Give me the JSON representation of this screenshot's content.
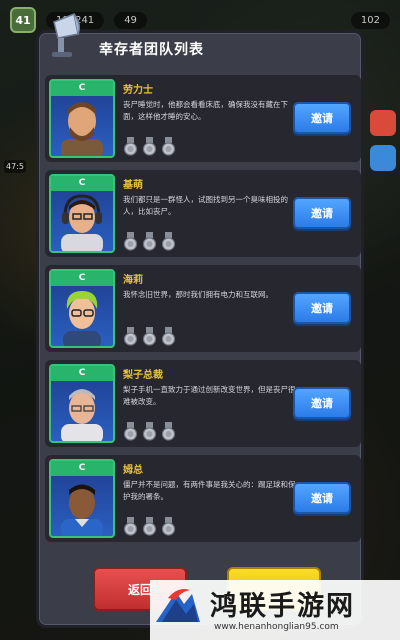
{
  "topbar": {
    "level": "41",
    "resource_left": "193241",
    "resource_mid": "49",
    "resource_right": "102"
  },
  "side": {
    "timer": "47:5"
  },
  "panel": {
    "title": "幸存者团队列表"
  },
  "survivors": [
    {
      "rank": "C",
      "name": "劳力士",
      "desc": "丧尸睡觉时，他都会看看床底，确保我没有藏在下面，这样他才睡的安心。",
      "medals": 3,
      "invite_label": "邀请",
      "portrait_icon": "bearded-man-portrait"
    },
    {
      "rank": "C",
      "name": "基萌",
      "desc": "我们都只是一群怪人，试图找到另一个臭味相投的人，比如丧尸。",
      "medals": 3,
      "invite_label": "邀请",
      "portrait_icon": "headphones-man-portrait"
    },
    {
      "rank": "C",
      "name": "海莉",
      "desc": "我怀念旧世界，那时我们拥有电力和互联网。",
      "medals": 3,
      "invite_label": "邀请",
      "portrait_icon": "green-hair-woman-portrait"
    },
    {
      "rank": "C",
      "name": "梨子总裁",
      "desc": "梨子手机一直致力于通过创新改变世界，但是丧尸很难被改变。",
      "medals": 3,
      "invite_label": "邀请",
      "portrait_icon": "grey-hair-man-portrait"
    },
    {
      "rank": "C",
      "name": "姆总",
      "desc": "僵尸并不是问题，有两件事是我关心的：踢足球和保护我的署条。",
      "medals": 3,
      "invite_label": "邀请",
      "portrait_icon": "footballer-portrait"
    }
  ],
  "footer": {
    "back_label": "返回"
  },
  "watermark": {
    "title": "鸿联手游网",
    "url": "www.henanhonglian95.com"
  },
  "colors": {
    "panel_bg": "#3b3d48",
    "card_bg": "#26272f",
    "name": "#e8c13c",
    "invite": "#2c7be8",
    "back": "#c02f30",
    "confirm": "#e6b800",
    "rank": "#28b56b"
  }
}
